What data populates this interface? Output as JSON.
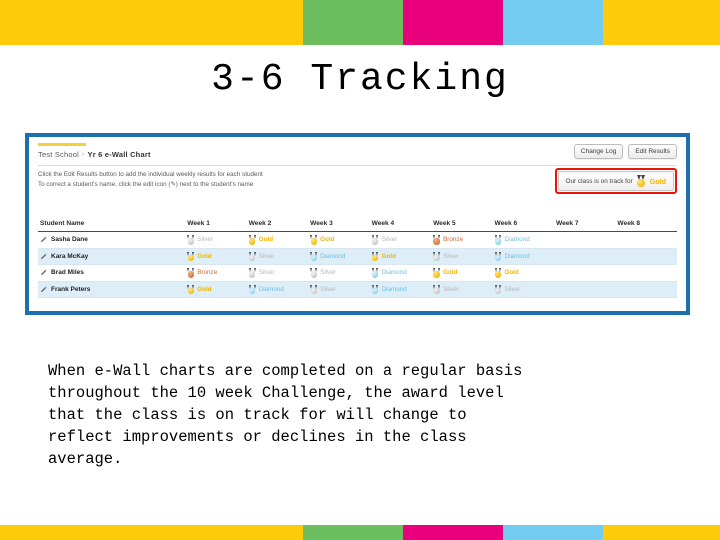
{
  "slide": {
    "title": "3-6 Tracking",
    "body_text": "When e-Wall charts are completed on a regular basis\nthroughout the 10 week Challenge, the award level\nthat the class is on track for will change to\nreflect improvements or declines in the class\naverage."
  },
  "decor": {
    "colors": {
      "yellow": "#fdcb0a",
      "green": "#6cbe5f",
      "pink": "#e9007c",
      "blue": "#74cdf0"
    }
  },
  "screenshot": {
    "frame_color": "#1e6fad",
    "breadcrumb": {
      "school": "Test School",
      "separator": "›",
      "current": "Yr 6 e-Wall Chart"
    },
    "buttons": {
      "change_log": "Change Log",
      "edit_results": "Edit Results"
    },
    "award_banner": {
      "text": "Our class is on track for",
      "level": "Gold",
      "medal": "gold-medal-icon",
      "highlight_color": "#e8140c"
    },
    "instructions": [
      "Click the Edit Results button to add the individual weekly results for each student",
      "To correct a student's name, click the edit icon (✎) next to the student's name"
    ],
    "table": {
      "headers": [
        "Student Name",
        "Week 1",
        "Week 2",
        "Week 3",
        "Week 4",
        "Week 5",
        "Week 6",
        "Week 7",
        "Week 8"
      ],
      "rows": [
        {
          "name": "Sasha Dane",
          "weeks": [
            "Silver",
            "Gold",
            "Gold",
            "Silver",
            "Bronze",
            "Diamond",
            "",
            ""
          ]
        },
        {
          "name": "Kara McKay",
          "weeks": [
            "Gold",
            "Silver",
            "Diamond",
            "Gold",
            "Silver",
            "Diamond",
            "",
            ""
          ]
        },
        {
          "name": "Brad Miles",
          "weeks": [
            "Bronze",
            "Silver",
            "Silver",
            "Diamond",
            "Gold",
            "Gold",
            "",
            ""
          ]
        },
        {
          "name": "Frank Peters",
          "weeks": [
            "Gold",
            "Diamond",
            "Silver",
            "Diamond",
            "Silver",
            "Silver",
            "",
            ""
          ]
        }
      ],
      "award_colors": {
        "Gold": "#f0b400",
        "Silver": "#b6b6b6",
        "Bronze": "#cf6a35",
        "Diamond": "#6ec1e4"
      }
    }
  }
}
